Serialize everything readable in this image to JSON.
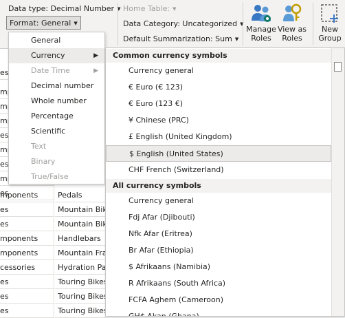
{
  "ribbon": {
    "data_type_label": "Data type: Decimal Number",
    "format_label": "Format: General",
    "home_table_label": "Home Table:",
    "data_category_label": "Data Category: Uncategorized",
    "default_summarization_label": "Default Summarization: Sum",
    "manage_roles": [
      "Manage",
      "Roles"
    ],
    "view_as_roles": [
      "View as",
      "Roles"
    ],
    "new_group": [
      "New",
      "Group"
    ]
  },
  "grid": {
    "left_fragments": [
      "es",
      "mp",
      "mp",
      "mp",
      "es",
      "mp",
      "es",
      "mp",
      "es",
      "mp",
      "mponents",
      "es",
      "es",
      "mponents",
      "mponents",
      "cessories",
      "es",
      "es",
      "es"
    ],
    "categories": [
      "Pedals",
      "Mountain Bikes",
      "Mountain Bikes",
      "Handlebars",
      "Mountain Frames",
      "Hydration Packs",
      "Touring Bikes",
      "Touring Bikes",
      "Touring Bikes"
    ]
  },
  "format_menu": {
    "items": [
      {
        "label": "General",
        "enabled": true
      },
      {
        "label": "Currency",
        "enabled": true,
        "submenu": true,
        "selected": true
      },
      {
        "label": "Date Time",
        "enabled": false,
        "submenu": true
      },
      {
        "label": "Decimal number",
        "enabled": true
      },
      {
        "label": "Whole number",
        "enabled": true
      },
      {
        "label": "Percentage",
        "enabled": true
      },
      {
        "label": "Scientific",
        "enabled": true
      },
      {
        "label": "Text",
        "enabled": false
      },
      {
        "label": "Binary",
        "enabled": false
      },
      {
        "label": "True/False",
        "enabled": false
      }
    ]
  },
  "currency_menu": {
    "common_header": "Common currency symbols",
    "common_items": [
      "Currency general",
      "€ Euro (€ 123)",
      "€ Euro (123 €)",
      "¥ Chinese (PRC)",
      "£ English (United Kingdom)",
      "$ English (United States)",
      "CHF French (Switzerland)"
    ],
    "all_header": "All currency symbols",
    "all_items": [
      "Currency general",
      "Fdj Afar (Djibouti)",
      "Nfk Afar (Eritrea)",
      "Br Afar (Ethiopia)",
      "$ Afrikaans (Namibia)",
      "R Afrikaans (South Africa)",
      "FCFA Aghem (Cameroon)",
      "GH₵ Akan (Ghana)"
    ]
  },
  "colors": {
    "accent": "#117865",
    "ribbon_bg": "#f3f2f1",
    "menu_border": "#c8c6c4",
    "disabled_text": "#a19f9d"
  }
}
